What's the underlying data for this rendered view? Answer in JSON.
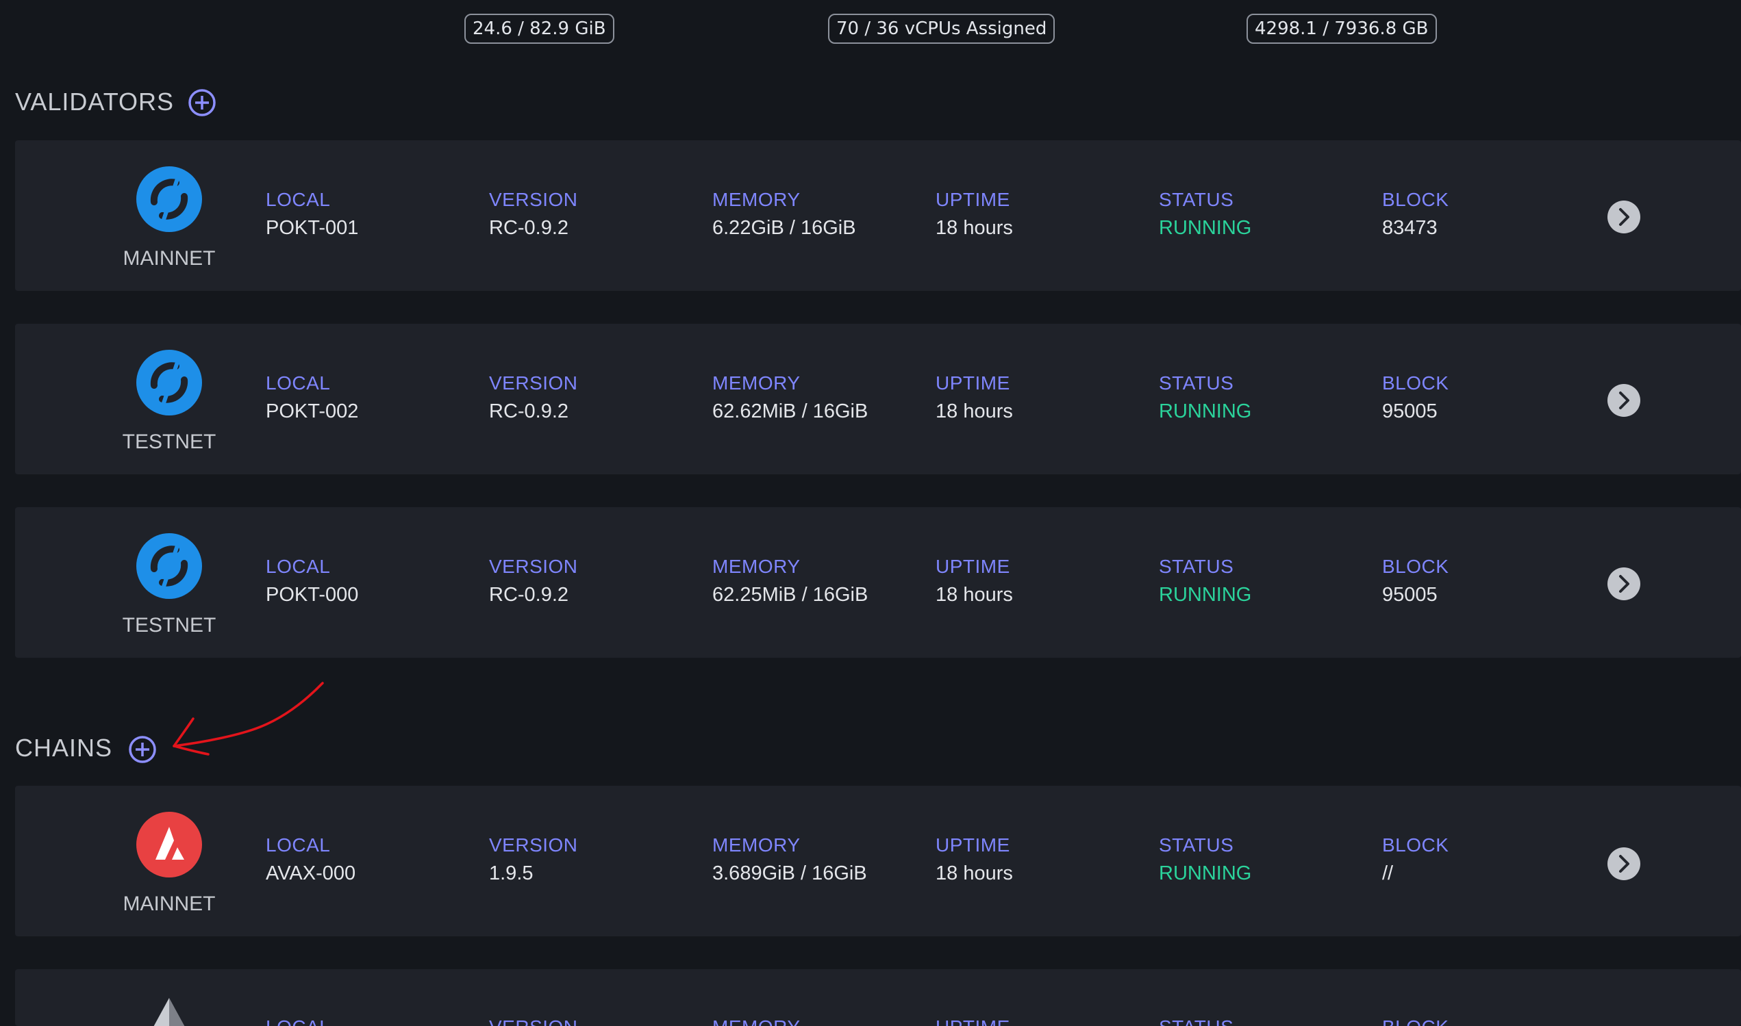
{
  "header_stats": [
    {
      "text": "24.6 / 82.9 GiB"
    },
    {
      "text": "70 / 36 vCPUs Assigned"
    },
    {
      "text": "4298.1 / 7936.8 GB"
    }
  ],
  "sections": {
    "validators": {
      "title": "VALIDATORS",
      "add_icon": "plus-circle-icon",
      "cards": [
        {
          "network": "MAINNET",
          "icon": "pokt-logo",
          "local_label": "LOCAL",
          "local": "POKT-001",
          "version_label": "VERSION",
          "version": "RC-0.9.2",
          "memory_label": "MEMORY",
          "memory": "6.22GiB / 16GiB",
          "uptime_label": "UPTIME",
          "uptime": "18 hours",
          "status_label": "STATUS",
          "status": "RUNNING",
          "block_label": "BLOCK",
          "block": "83473"
        },
        {
          "network": "TESTNET",
          "icon": "pokt-logo",
          "local_label": "LOCAL",
          "local": "POKT-002",
          "version_label": "VERSION",
          "version": "RC-0.9.2",
          "memory_label": "MEMORY",
          "memory": "62.62MiB / 16GiB",
          "uptime_label": "UPTIME",
          "uptime": "18 hours",
          "status_label": "STATUS",
          "status": "RUNNING",
          "block_label": "BLOCK",
          "block": "95005"
        },
        {
          "network": "TESTNET",
          "icon": "pokt-logo",
          "local_label": "LOCAL",
          "local": "POKT-000",
          "version_label": "VERSION",
          "version": "RC-0.9.2",
          "memory_label": "MEMORY",
          "memory": "62.25MiB / 16GiB",
          "uptime_label": "UPTIME",
          "uptime": "18 hours",
          "status_label": "STATUS",
          "status": "RUNNING",
          "block_label": "BLOCK",
          "block": "95005"
        }
      ]
    },
    "chains": {
      "title": "CHAINS",
      "add_icon": "plus-circle-icon",
      "cards": [
        {
          "network": "MAINNET",
          "icon": "avalanche-logo",
          "local_label": "LOCAL",
          "local": "AVAX-000",
          "version_label": "VERSION",
          "version": "1.9.5",
          "memory_label": "MEMORY",
          "memory": "3.689GiB / 16GiB",
          "uptime_label": "UPTIME",
          "uptime": "18 hours",
          "status_label": "STATUS",
          "status": "RUNNING",
          "block_label": "BLOCK",
          "block": "//"
        },
        {
          "network": "",
          "icon": "ethereum-logo",
          "local_label": "LOCAL",
          "local": "",
          "version_label": "VERSION",
          "version": "",
          "memory_label": "MEMORY",
          "memory": "",
          "uptime_label": "UPTIME",
          "uptime": "",
          "status_label": "STATUS",
          "status": "",
          "block_label": "BLOCK",
          "block": ""
        }
      ]
    }
  },
  "colors": {
    "background": "#14171c",
    "card": "#1f2229",
    "label_accent": "#7f86ff",
    "status_running": "#2bd39b",
    "pokt_blue": "#1e8fe8",
    "avax_red": "#e84142",
    "annotation_red": "#e3141b"
  },
  "annotation": {
    "type": "hand-drawn-arrow",
    "points_to": "chains-add-button"
  }
}
